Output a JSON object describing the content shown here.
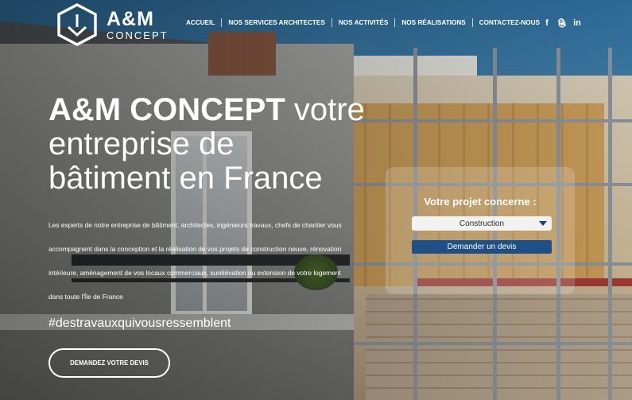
{
  "brand": {
    "name": "A&M",
    "sub": "CONCEPT"
  },
  "nav": {
    "items": [
      {
        "label": "ACCUEIL"
      },
      {
        "label": "NOS SERVICES ARCHITECTES"
      },
      {
        "label": "NOS ACTIVITÉS"
      },
      {
        "label": "NOS RÉALISATIONS"
      },
      {
        "label": "CONTACTEZ-NOUS"
      }
    ],
    "search_icon": "search-icon"
  },
  "social": {
    "facebook": "f",
    "instagram": "◎",
    "linkedin": "in"
  },
  "hero": {
    "title_bold": "A&M CONCEPT",
    "title_light_1": " votre",
    "title_light_2": "entreprise de",
    "title_light_3": "bâtiment en France",
    "description": "Les experts de notre entreprise de bâtiment, architectes, ingénieurs travaux, chefs de chantier vous accompagnent dans la conception et la réalisation de vos projets de construction neuve, rénovation intérieure, aménagement de vos locaux commerciaux, surélévation ou extension de votre logement dans toute l'Île de France",
    "hashtag": "#destravauxquivousressemblent",
    "cta_label": "DEMANDEZ VOTRE DEVIS"
  },
  "project_panel": {
    "title": "Votre projet concerne :",
    "select_value": "Construction",
    "button_label": "Demander un devis"
  },
  "colors": {
    "button_blue": "#1e4f87",
    "select_arrow": "#1f3f70"
  }
}
